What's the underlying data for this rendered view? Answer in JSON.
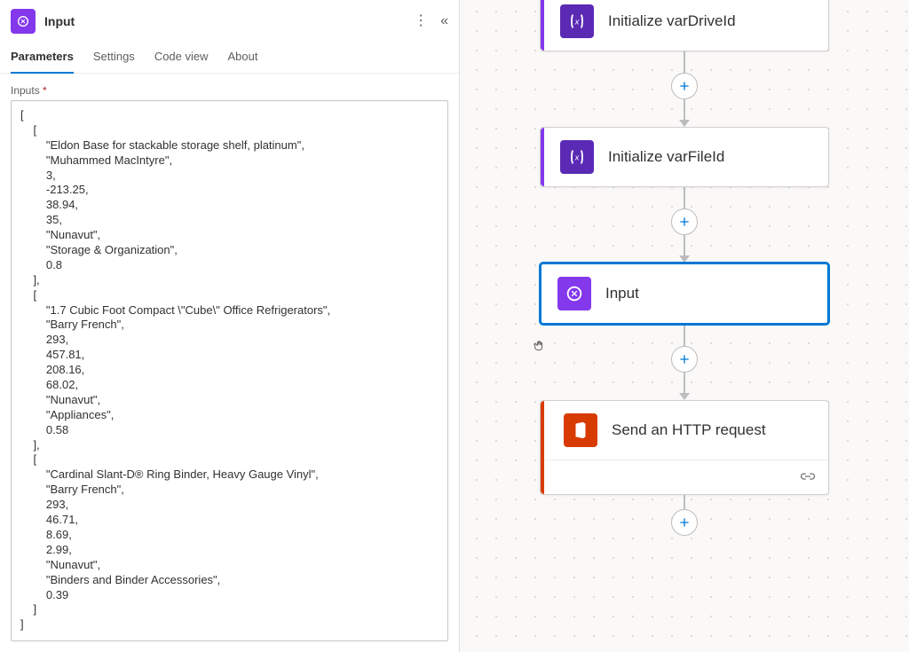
{
  "panel": {
    "title": "Input",
    "tabs": {
      "parameters": "Parameters",
      "settings": "Settings",
      "codeview": "Code view",
      "about": "About"
    },
    "inputs_label": "Inputs",
    "required_marker": "*",
    "inputs_value": "[\n    [\n        \"Eldon Base for stackable storage shelf, platinum\",\n        \"Muhammed MacIntyre\",\n        3,\n        -213.25,\n        38.94,\n        35,\n        \"Nunavut\",\n        \"Storage & Organization\",\n        0.8\n    ],\n    [\n        \"1.7 Cubic Foot Compact \\\"Cube\\\" Office Refrigerators\",\n        \"Barry French\",\n        293,\n        457.81,\n        208.16,\n        68.02,\n        \"Nunavut\",\n        \"Appliances\",\n        0.58\n    ],\n    [\n        \"Cardinal Slant-D® Ring Binder, Heavy Gauge Vinyl\",\n        \"Barry French\",\n        293,\n        46.71,\n        8.69,\n        2.99,\n        \"Nunavut\",\n        \"Binders and Binder Accessories\",\n        0.39\n    ]\n]"
  },
  "flow": {
    "node1": "Initialize varDriveId",
    "node2": "Initialize varFileId",
    "node3": "Input",
    "node4": "Send an HTTP request"
  },
  "icons": {
    "compose": "compose-icon",
    "variable": "variable-icon",
    "office": "office-icon",
    "link": "link-icon"
  }
}
